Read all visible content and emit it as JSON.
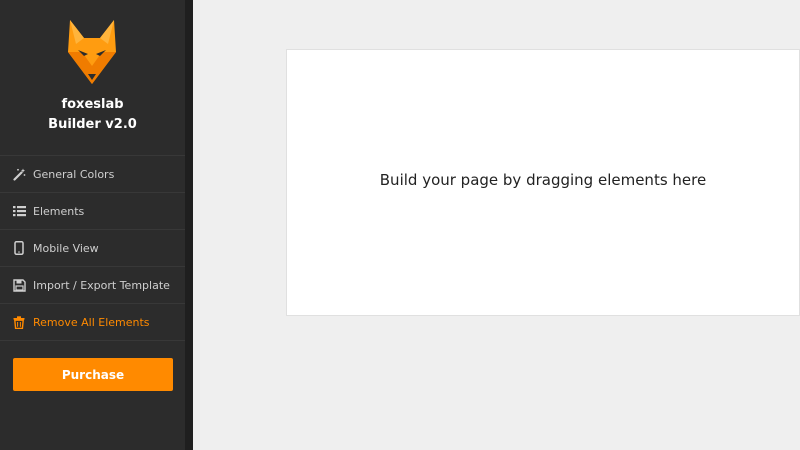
{
  "brand": {
    "name": "foxeslab",
    "subtitle": "Builder v2.0"
  },
  "sidebar": {
    "items": [
      {
        "label": "General Colors",
        "icon": "magic-wand-icon"
      },
      {
        "label": "Elements",
        "icon": "list-icon"
      },
      {
        "label": "Mobile View",
        "icon": "mobile-icon"
      },
      {
        "label": "Import / Export Template",
        "icon": "save-icon"
      },
      {
        "label": "Remove All Elements",
        "icon": "trash-icon"
      }
    ],
    "purchase_label": "Purchase"
  },
  "canvas": {
    "placeholder": "Build your page by dragging elements here"
  },
  "colors": {
    "accent": "#ff8a00",
    "sidebar_bg": "#2c2c2c",
    "page_bg": "#efefef"
  }
}
